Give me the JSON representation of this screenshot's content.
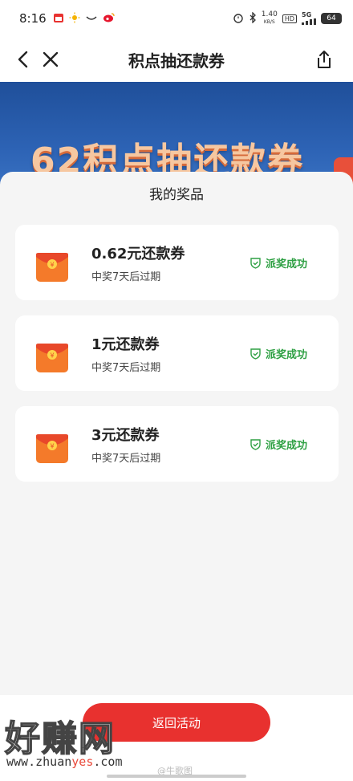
{
  "status_bar": {
    "time": "8:16",
    "net_speed_value": "1.40",
    "net_speed_unit": "KB/S",
    "hd_label": "HD",
    "signal_label": "5G",
    "battery": "64"
  },
  "nav": {
    "title": "积点抽还款券"
  },
  "banner": {
    "text": "62积点抽还款券"
  },
  "sheet": {
    "title": "我的奖品",
    "prizes": [
      {
        "name": "0.62元还款券",
        "sub": "中奖7天后过期",
        "status": "派奖成功"
      },
      {
        "name": "1元还款券",
        "sub": "中奖7天后过期",
        "status": "派奖成功"
      },
      {
        "name": "3元还款券",
        "sub": "中奖7天后过期",
        "status": "派奖成功"
      }
    ]
  },
  "bottom": {
    "return_label": "返回活动"
  },
  "watermark": {
    "logo_text": "好赚网",
    "url_part1": "www.zhuan",
    "url_part2": "yes",
    "url_part3": ".com",
    "weibo_text": "@牛歌图"
  },
  "colors": {
    "accent_red": "#e8312f",
    "success_green": "#2ea043",
    "envelope_orange": "#f47a2a"
  },
  "icons": {
    "back": "chevron-left-icon",
    "close": "close-icon",
    "share": "share-icon",
    "envelope": "red-envelope-icon",
    "status": "shield-check-icon"
  }
}
